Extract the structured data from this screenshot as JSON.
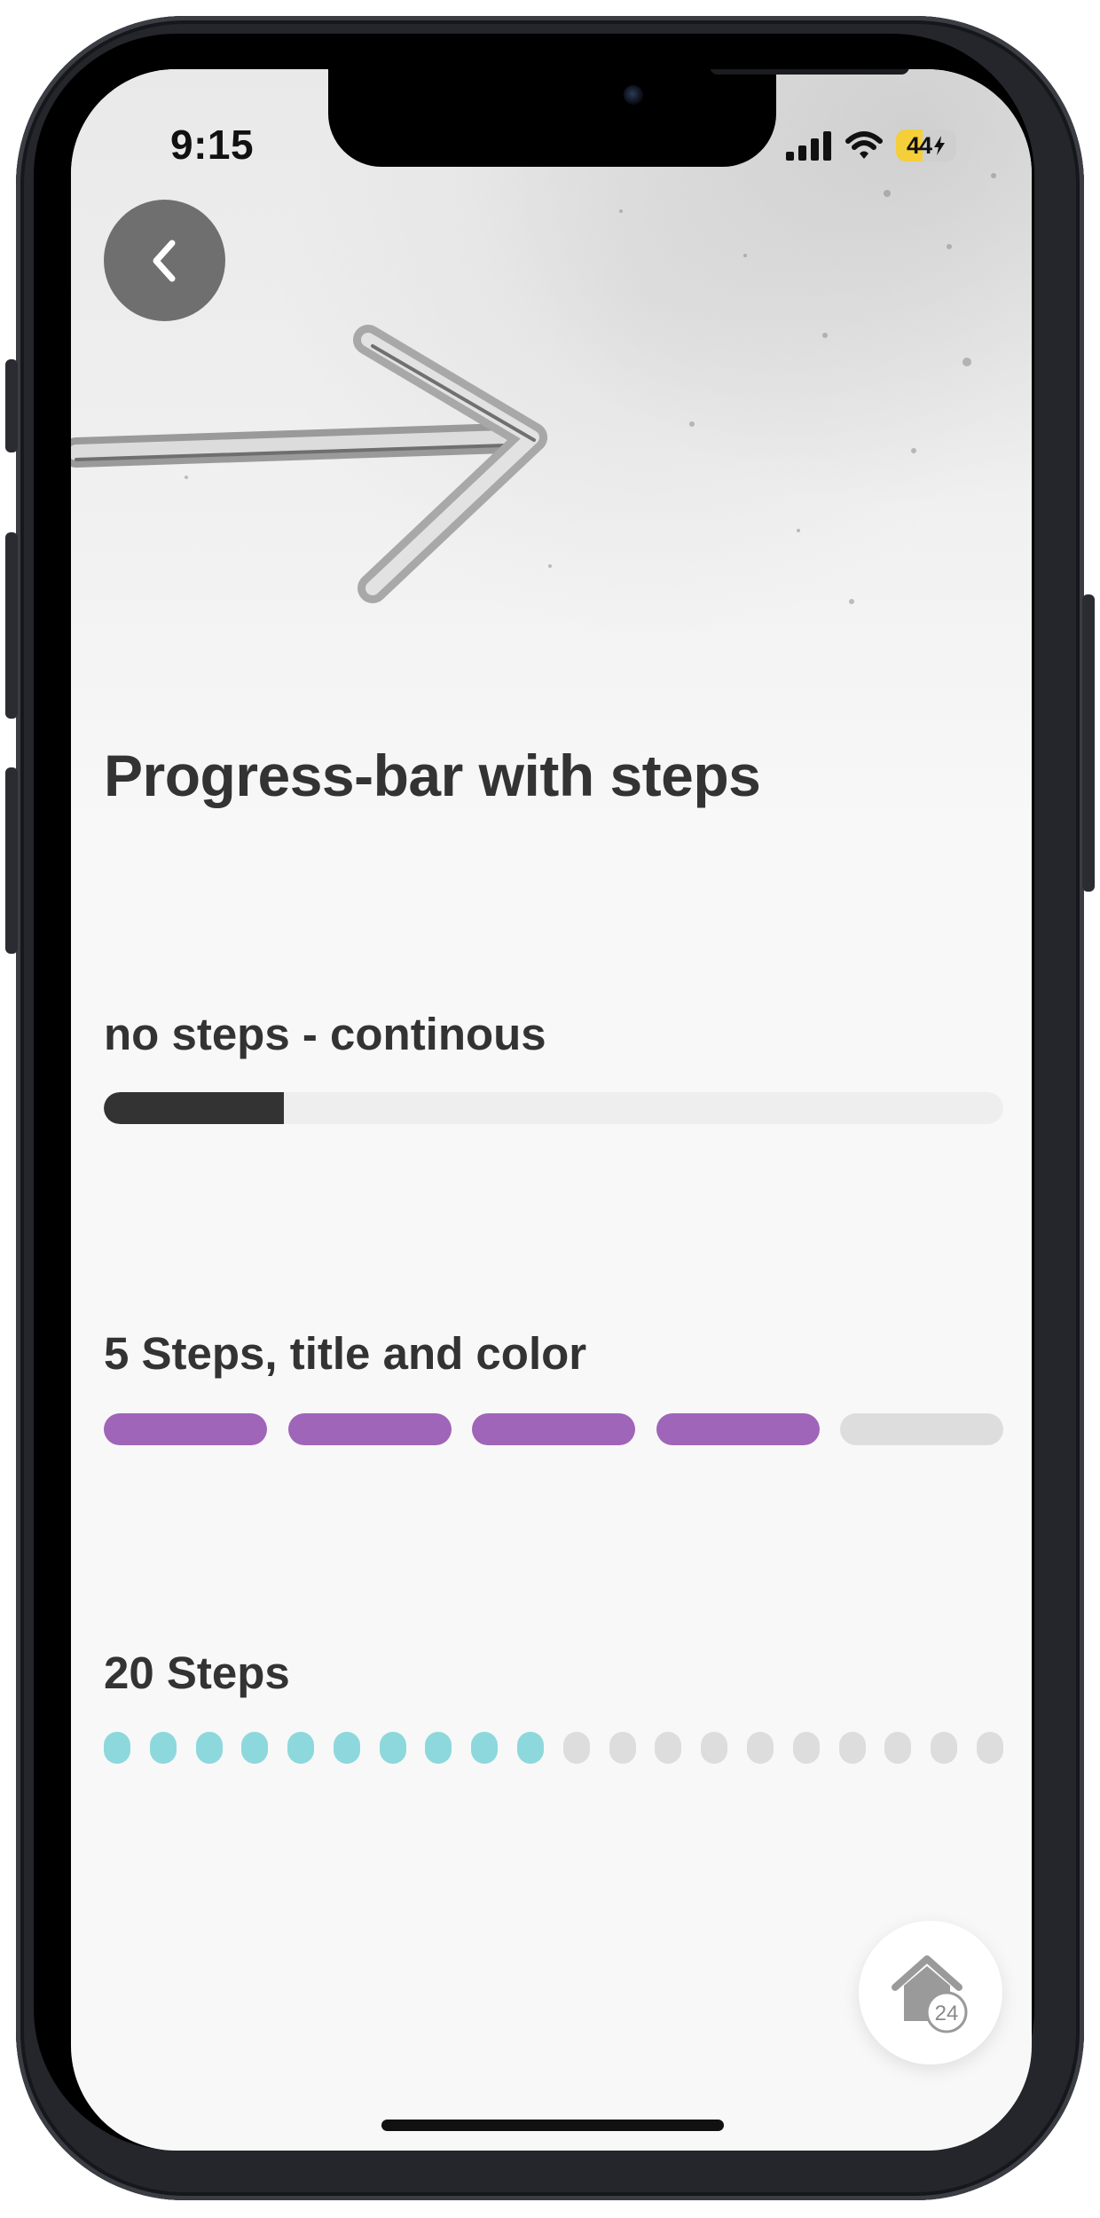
{
  "status_bar": {
    "time": "9:15",
    "battery_percent": "44",
    "battery_level": 0.44,
    "battery_color": "#f4cf3a"
  },
  "hero": {
    "image": "arrow-pointing-right-on-concrete"
  },
  "back_button": {
    "icon": "chevron-left-icon"
  },
  "page": {
    "title": "Progress-bar with steps"
  },
  "sections": [
    {
      "label": "no steps - continous",
      "progress": 0.2,
      "color": "#333333",
      "track_color": "#eeeeee"
    },
    {
      "label": "5 Steps, title and color",
      "steps_total": 5,
      "steps_done": 4,
      "color": "#9f65b8",
      "track_color": "#dddddd"
    },
    {
      "label": "20 Steps",
      "steps_total": 20,
      "steps_done": 10,
      "color": "#8dd8dc",
      "track_color": "#dddddd"
    }
  ],
  "home_button": {
    "icon": "home-icon",
    "badge": "24"
  }
}
